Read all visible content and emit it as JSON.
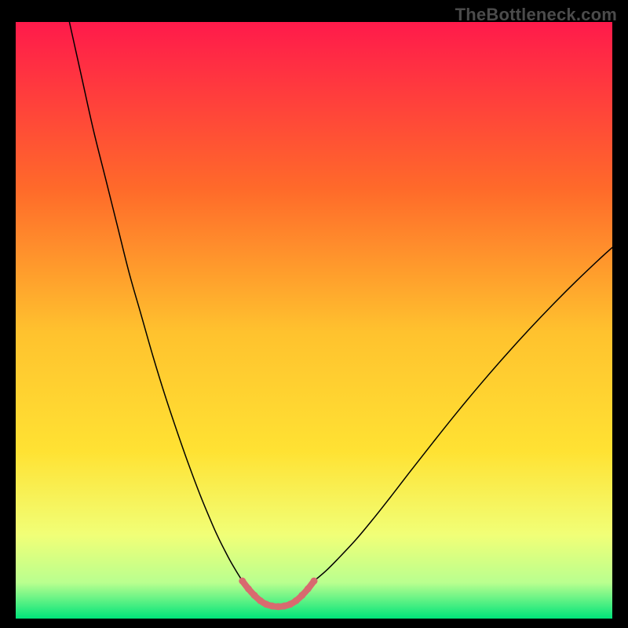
{
  "watermark": "TheBottleneck.com",
  "chart_data": {
    "type": "line",
    "title": "",
    "xlabel": "",
    "ylabel": "",
    "xlim": [
      0,
      100
    ],
    "ylim": [
      0,
      100
    ],
    "grid": false,
    "legend": false,
    "gradient": {
      "top": "#ff1a4b",
      "mid_upper": "#ff8a1f",
      "mid": "#ffe233",
      "mid_lower": "#f4ff66",
      "near_bottom": "#c8ff8a",
      "bottom": "#00e47a"
    },
    "series": [
      {
        "name": "curve-left",
        "color": "#000000",
        "width": 1.5,
        "x": [
          9.0,
          11,
          13,
          15,
          17,
          19,
          21,
          23,
          25,
          27,
          29,
          31,
          33,
          34,
          35,
          36,
          37,
          38
        ],
        "y": [
          100,
          91,
          82,
          74,
          66,
          58,
          51,
          44,
          37.5,
          31.5,
          25.8,
          20.5,
          15.7,
          13.5,
          11.5,
          9.6,
          7.9,
          6.3
        ]
      },
      {
        "name": "curve-right",
        "color": "#000000",
        "width": 1.5,
        "x": [
          50,
          52,
          54,
          57,
          60,
          63,
          66,
          70,
          74,
          78,
          82,
          86,
          90,
          94,
          98,
          100
        ],
        "y": [
          6.3,
          8.0,
          10.0,
          13.2,
          16.8,
          20.6,
          24.5,
          29.6,
          34.6,
          39.4,
          44.0,
          48.4,
          52.6,
          56.6,
          60.4,
          62.2
        ]
      },
      {
        "name": "bottom-highlight",
        "color": "#d86a6f",
        "width": 9,
        "cap": "round",
        "x": [
          38,
          39,
          40,
          41,
          42,
          43,
          44,
          45,
          46,
          47,
          48,
          49,
          50
        ],
        "y": [
          6.3,
          5.0,
          3.9,
          3.0,
          2.4,
          2.1,
          2.0,
          2.1,
          2.4,
          3.0,
          3.9,
          5.0,
          6.3
        ],
        "dotted": true
      }
    ]
  }
}
